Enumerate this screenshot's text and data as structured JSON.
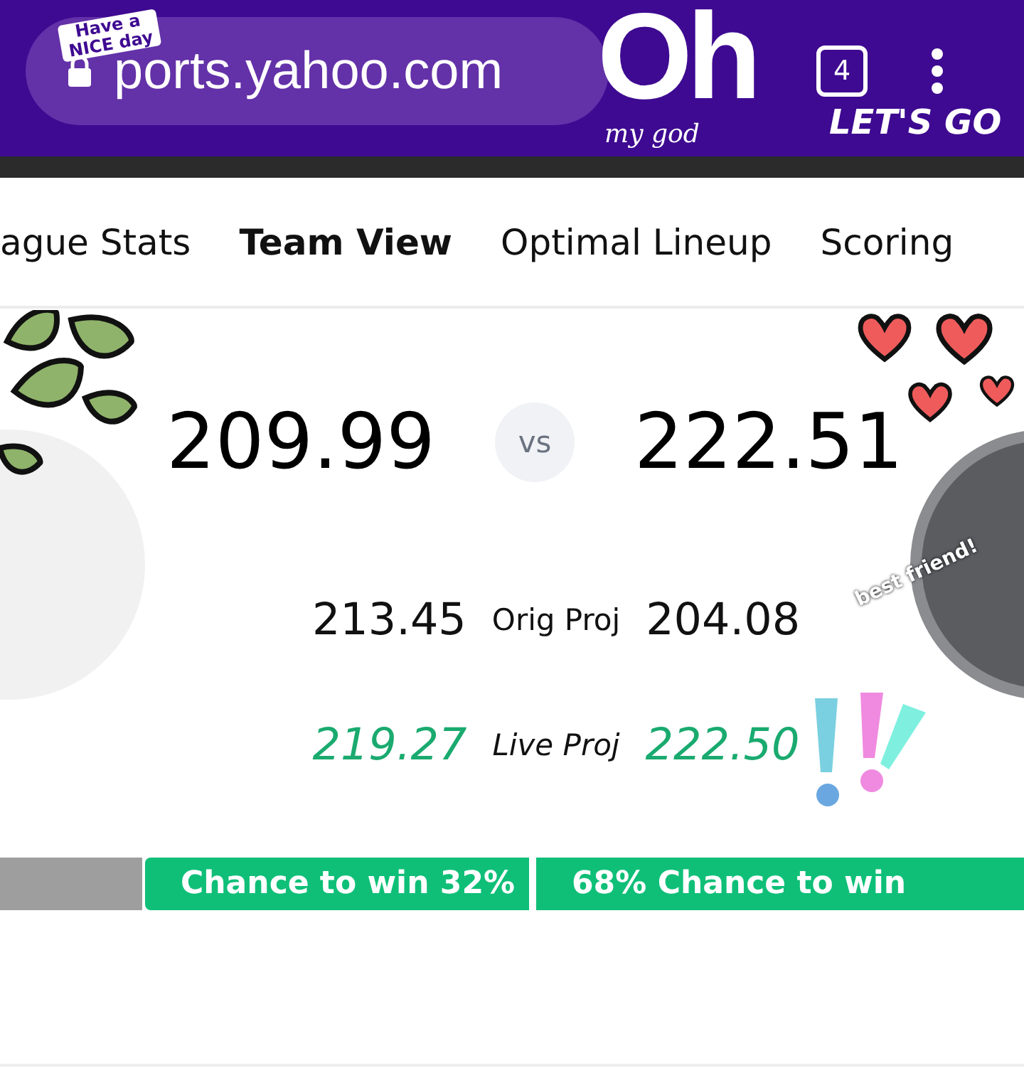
{
  "browser": {
    "url": "ports.yahoo.com",
    "tab_count": "4"
  },
  "tabs": [
    {
      "label": "ague Stats",
      "selected": false
    },
    {
      "label": "Team View",
      "selected": true
    },
    {
      "label": "Optimal Lineup",
      "selected": false
    },
    {
      "label": "Scoring",
      "selected": false
    }
  ],
  "matchup": {
    "home_score": "209.99",
    "vs": "vs",
    "away_score": "222.51",
    "orig_proj": {
      "label": "Orig Proj",
      "home": "213.45",
      "away": "204.08"
    },
    "live_proj": {
      "label": "Live Proj",
      "home": "219.27",
      "away": "222.50"
    }
  },
  "win_chance": [
    {
      "label": "Chance to win 32%"
    },
    {
      "label": "68% Chance to win"
    }
  ],
  "stickers": [
    {
      "kind": "banner",
      "text": "Have a NICE day"
    },
    {
      "kind": "big",
      "text": "Oh"
    },
    {
      "kind": "script",
      "text": "my god"
    },
    {
      "kind": "brush",
      "text": "LET'S GO"
    },
    {
      "kind": "badge",
      "text": "best friend!"
    }
  ]
}
